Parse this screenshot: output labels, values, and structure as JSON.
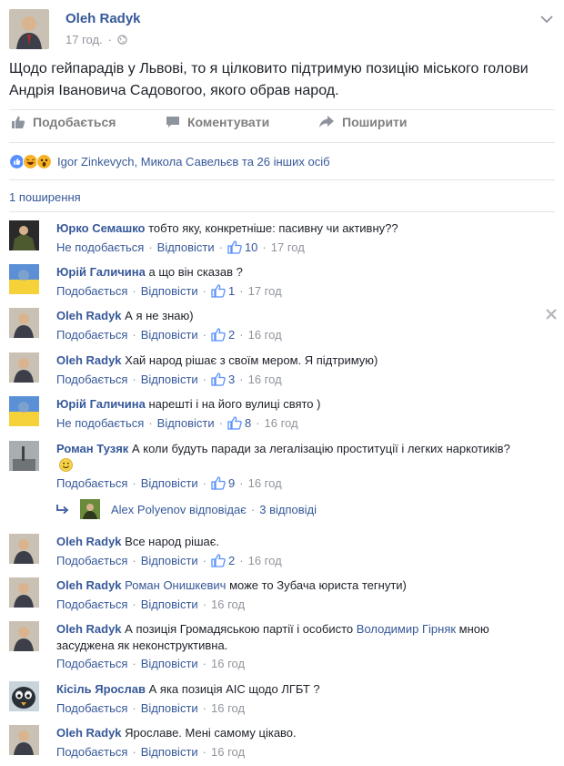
{
  "post": {
    "author": "Oleh Radyk",
    "time": "17 год.",
    "dot": "·",
    "text": "Щодо гейпарадів у Львові, то я цілковито підтримую позицію міського голови Андрія Івановича Садовогоо, якого обрав народ."
  },
  "actions": {
    "like": "Подобається",
    "comment": "Коментувати",
    "share": "Поширити"
  },
  "reactions": {
    "types": [
      "like-icon",
      "haha-icon",
      "wow-icon"
    ],
    "names": "Igor Zinkevych, Микола Савельєв та 26 інших осіб"
  },
  "shares": "1 поширення",
  "comments": [
    {
      "name": "Юрко Семашко",
      "text": "тобто яку, конкретніше: пасивну чи активну??",
      "like_label": "Не подобається",
      "reply": "Відповісти",
      "likes": "10",
      "time": "17 год"
    },
    {
      "name": "Юрій Галичина",
      "text": "а що він сказав ?",
      "like_label": "Подобається",
      "reply": "Відповісти",
      "likes": "1",
      "time": "17 год"
    },
    {
      "name": "Oleh Radyk",
      "text": "А я не знаю)",
      "like_label": "Подобається",
      "reply": "Відповісти",
      "likes": "2",
      "time": "16 год"
    },
    {
      "name": "Oleh Radyk",
      "text": "Хай народ рішає з своїм мером. Я підтримую)",
      "like_label": "Подобається",
      "reply": "Відповісти",
      "likes": "3",
      "time": "16 год"
    },
    {
      "name": "Юрій Галичина",
      "text": "нарешті і на його вулиці свято )",
      "like_label": "Не подобається",
      "reply": "Відповісти",
      "likes": "8",
      "time": "16 год"
    },
    {
      "name": "Роман Тузяк",
      "text": "А коли будуть паради за легалізацію проституції і легких наркотиків?",
      "like_label": "Подобається",
      "reply": "Відповісти",
      "likes": "9",
      "time": "16 год"
    },
    {
      "name": "Oleh Radyk",
      "text": "Все народ рішає.",
      "like_label": "Подобається",
      "reply": "Відповісти",
      "likes": "2",
      "time": "16 год"
    },
    {
      "name": "Oleh Radyk",
      "mention": "Роман Онишкевич",
      "text": "може то Зубача юриста тегнути)",
      "like_label": "Подобається",
      "reply": "Відповісти",
      "time": "16 год"
    },
    {
      "name": "Oleh Radyk",
      "text": "А позиція Громадяською партії і особисто",
      "mention": "Володимир Гірняк",
      "text2": "мною засуджена як неконструктивна.",
      "like_label": "Подобається",
      "reply": "Відповісти",
      "time": "16 год"
    },
    {
      "name": "Кісіль Ярослав",
      "text": "А яка позиція АІС щодо ЛГБТ ?",
      "like_label": "Подобається",
      "reply": "Відповісти",
      "time": "16 год"
    },
    {
      "name": "Oleh Radyk",
      "text": "Ярославе. Мені самому цікаво.",
      "like_label": "Подобається",
      "reply": "Відповісти",
      "time": "16 год"
    }
  ],
  "reply_thread": {
    "name": "Alex Polyenov відповідає",
    "count": "3 відповіді"
  },
  "sep": "·",
  "colors": {
    "link": "#365899",
    "meta": "#90949c",
    "text": "#1d2129",
    "like_blue": "#5890ff"
  }
}
